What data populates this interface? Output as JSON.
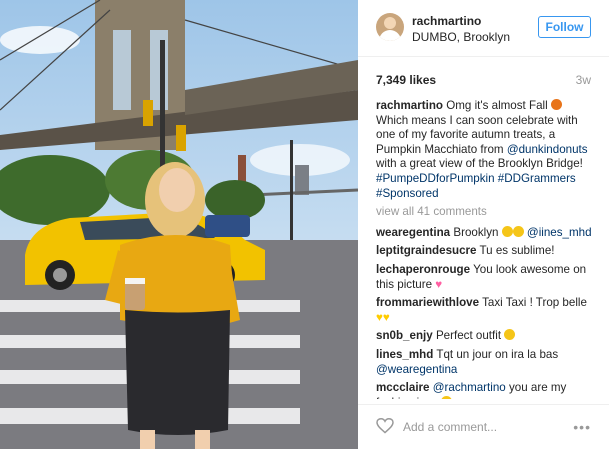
{
  "header": {
    "username": "rachmartino",
    "location": "DUMBO, Brooklyn",
    "follow_label": "Follow"
  },
  "stats": {
    "likes": "7,349 likes",
    "time_ago": "3w"
  },
  "caption": {
    "username": "rachmartino",
    "text_before": "Omg it's almost Fall",
    "text_after": "Which means I can soon celebrate with one of my favorite autumn treats, a Pumpkin Macchiato from",
    "mention": "@dunkindonuts",
    "text_end": "with a great view of the Brooklyn Bridge!",
    "hashtags": "#PumpeDDforPumpkin #DDGrammers #Sponsored"
  },
  "view_all": "view all 41 comments",
  "comments": [
    {
      "user": "wearegentina",
      "text": "Brooklyn",
      "mention": "@iines_mhd",
      "emoji": "star-eyes-emoji x2"
    },
    {
      "user": "leptitgraindesucre",
      "text": "Tu es sublime!"
    },
    {
      "user": "lechaperonrouge",
      "text": "You look awesome on this picture",
      "emoji": "pink-heart-emoji"
    },
    {
      "user": "frommariewithlove",
      "text": "Taxi Taxi ! Trop belle",
      "emoji": "yellow-heart-emoji x2"
    },
    {
      "user": "sn0b_enjy",
      "text": "Perfect outfit",
      "emoji": "smile-emoji"
    },
    {
      "user": "lines_mhd",
      "text": "Tqt un jour on ira la bas",
      "mention": "@wearegentina"
    },
    {
      "user": "mccclaire",
      "mention": "@rachmartino",
      "text": "you are my fashion icon",
      "emoji": "raised-hands-emoji"
    }
  ],
  "footer": {
    "add_comment_placeholder": "Add a comment...",
    "more_label": "•••"
  },
  "colors": {
    "accent": "#3897f0",
    "taxi": "#f2c200",
    "blouse": "#e8a812"
  }
}
